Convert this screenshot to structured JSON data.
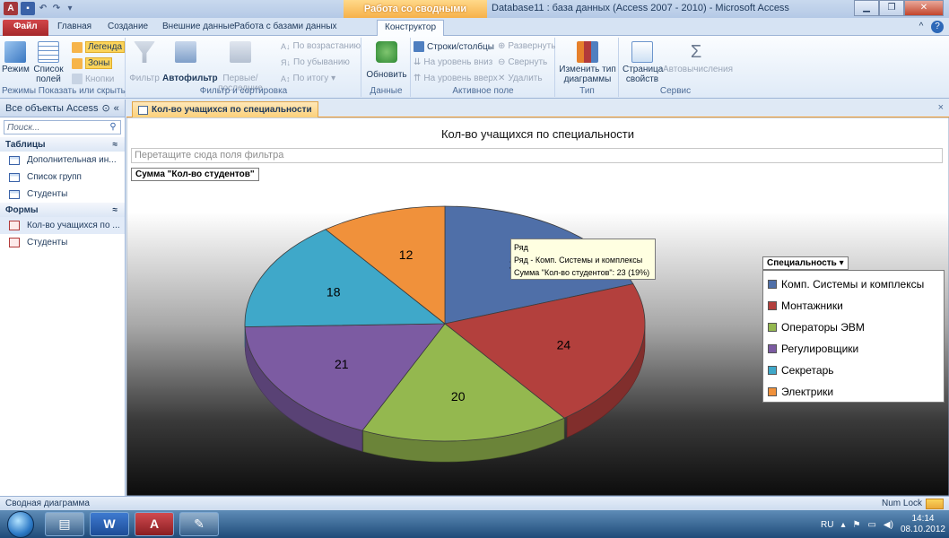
{
  "window": {
    "title": "Database11 : база данных (Access 2007 - 2010) - Microsoft Access",
    "context_tab_group": "Работа со сводными диаграммами"
  },
  "tabs": {
    "file": "Файл",
    "home": "Главная",
    "create": "Создание",
    "external": "Внешние данные",
    "dbtools": "Работа с базами данных",
    "design": "Конструктор"
  },
  "ribbon": {
    "mode": "Режим",
    "field_list_1": "Список",
    "field_list_2": "полей",
    "legend": "Легенда",
    "zones": "Зоны",
    "buttons": "Кнопки",
    "group_show_hide": "Режимы  Показать или скрыть",
    "filter": "Фильтр",
    "autofilter": "Автофильтр",
    "top_bottom": "Первые/последние",
    "sort_asc": "По возрастанию",
    "sort_desc": "По убыванию",
    "by_total": "По итогу ▾",
    "group_filter_sort": "Фильтр и сортировка",
    "refresh": "Обновить",
    "group_data": "Данные",
    "rows_cols": "Строки/столбцы",
    "expand": "Развернуть",
    "drill_down": "На уровень вниз",
    "collapse": "Свернуть",
    "drill_up": "На уровень вверх",
    "delete": "Удалить",
    "group_active_field": "Активное поле",
    "change_type_1": "Изменить тип",
    "change_type_2": "диаграммы",
    "group_type": "Тип",
    "property_sheet_1": "Страница",
    "property_sheet_2": "свойств",
    "autocalc": "Автовычисления",
    "group_service": "Сервис"
  },
  "nav": {
    "header": "Все объекты Access",
    "search_placeholder": "Поиск...",
    "cat_tables": "Таблицы",
    "tables": [
      "Дополнительная ин...",
      "Список групп",
      "Студенты"
    ],
    "cat_forms": "Формы",
    "forms": [
      "Кол-во учащихся по ...",
      "Студенты"
    ]
  },
  "doc": {
    "tab_title": "Кол-во учащихся по специальности",
    "filter_zone": "Перетащите сюда поля фильтра",
    "data_field": "Сумма \"Кол-во студентов\"",
    "legend_title": "Специальность ▾",
    "tooltip": [
      "Ряд",
      "Ряд - Комп. Системы и комплексы",
      "Сумма \"Кол-во студентов\": 23 (19%)"
    ]
  },
  "chart_data": {
    "type": "pie",
    "title": "Кол-во учащихся по специальности",
    "categories": [
      "Комп. Системы и комплексы",
      "Монтажники",
      "Операторы ЭВМ",
      "Регулировщики",
      "Секретарь",
      "Электрики"
    ],
    "values": [
      23,
      24,
      20,
      21,
      18,
      12
    ],
    "colors": [
      "#4f6fa8",
      "#b3403d",
      "#94b84f",
      "#7c5ba2",
      "#3fa8c9",
      "#f0913b"
    ],
    "three_d": true,
    "legend_placement": "right"
  },
  "status": {
    "left": "Сводная диаграмма",
    "num_lock": "Num Lock"
  },
  "taskbar": {
    "lang": "RU",
    "time": "14:14",
    "date": "08.10.2012"
  }
}
